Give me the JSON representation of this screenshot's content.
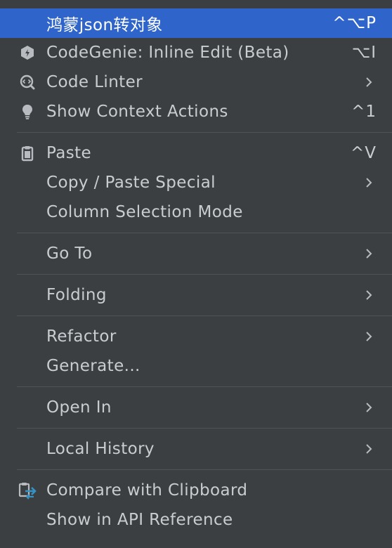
{
  "menu": {
    "items": [
      {
        "label": "鸿蒙json转对象",
        "shortcut": "^⌥P",
        "icon": "none",
        "submenu": false,
        "selected": true
      },
      {
        "label": "CodeGenie: Inline Edit (Beta)",
        "shortcut": "⌥I",
        "icon": "codegenie-icon",
        "submenu": false,
        "selected": false
      },
      {
        "label": "Code Linter",
        "shortcut": "",
        "icon": "code-linter-icon",
        "submenu": true,
        "selected": false
      },
      {
        "label": "Show Context Actions",
        "shortcut": "^1",
        "icon": "lightbulb-icon",
        "submenu": false,
        "selected": false
      },
      {
        "label": "Paste",
        "shortcut": "^V",
        "icon": "clipboard-icon",
        "submenu": false,
        "selected": false
      },
      {
        "label": "Copy / Paste Special",
        "shortcut": "",
        "icon": "none",
        "submenu": true,
        "selected": false
      },
      {
        "label": "Column Selection Mode",
        "shortcut": "",
        "icon": "none",
        "submenu": false,
        "selected": false
      },
      {
        "label": "Go To",
        "shortcut": "",
        "icon": "none",
        "submenu": true,
        "selected": false
      },
      {
        "label": "Folding",
        "shortcut": "",
        "icon": "none",
        "submenu": true,
        "selected": false
      },
      {
        "label": "Refactor",
        "shortcut": "",
        "icon": "none",
        "submenu": true,
        "selected": false
      },
      {
        "label": "Generate...",
        "shortcut": "",
        "icon": "none",
        "submenu": false,
        "selected": false
      },
      {
        "label": "Open In",
        "shortcut": "",
        "icon": "none",
        "submenu": true,
        "selected": false
      },
      {
        "label": "Local History",
        "shortcut": "",
        "icon": "none",
        "submenu": true,
        "selected": false
      },
      {
        "label": "Compare with Clipboard",
        "shortcut": "",
        "icon": "compare-clipboard-icon",
        "submenu": false,
        "selected": false
      },
      {
        "label": "Show in API Reference",
        "shortcut": "",
        "icon": "none",
        "submenu": false,
        "selected": false
      }
    ]
  },
  "colors": {
    "background": "#3c3f41",
    "selected": "#2f65ca",
    "text": "#c9cdd1",
    "separator": "#505355",
    "accent_icon": "#3592c4"
  }
}
